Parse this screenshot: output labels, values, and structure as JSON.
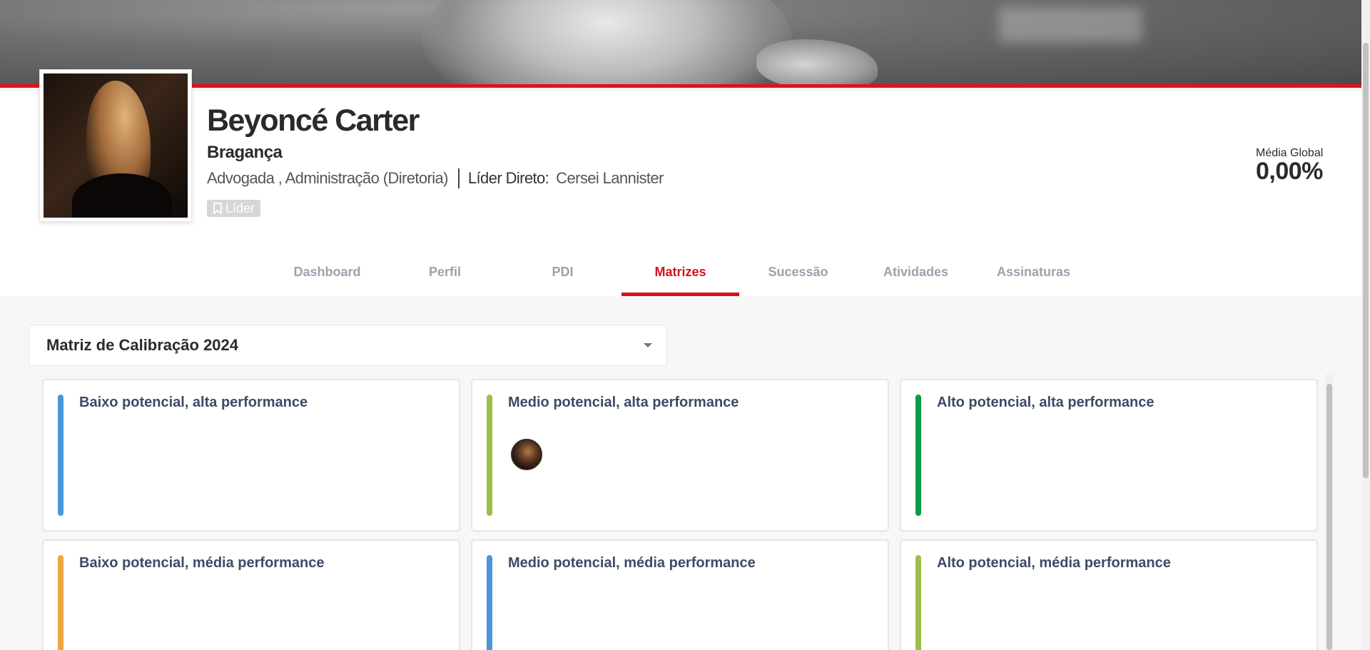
{
  "profile": {
    "name": "Beyoncé Carter",
    "subname": "Bragança",
    "role": "Advogada , Administração (Diretoria)",
    "leader_label": "Líder Direto:",
    "leader_name": "Cersei Lannister",
    "badge": "Líder",
    "badge_icon": "bookmark-icon"
  },
  "media_global": {
    "label": "Média Global",
    "value": "0,00%"
  },
  "tabs": [
    {
      "label": "Dashboard"
    },
    {
      "label": "Perfil"
    },
    {
      "label": "PDI"
    },
    {
      "label": "Matrizes",
      "active": true
    },
    {
      "label": "Sucessão"
    },
    {
      "label": "Atividades"
    },
    {
      "label": "Assinaturas"
    }
  ],
  "matrix_select": {
    "value": "Matriz de Calibração 2024"
  },
  "matrix": {
    "cells": [
      {
        "title": "Baixo potencial, alta performance",
        "color": "#4a98db"
      },
      {
        "title": "Medio potencial, alta performance",
        "color": "#9bc04a"
      },
      {
        "title": "Alto potencial, alta performance",
        "color": "#0f9a4a"
      },
      {
        "title": "Baixo potencial, média performance",
        "color": "#eba73f"
      },
      {
        "title": "Medio potencial, média performance",
        "color": "#4a98db"
      },
      {
        "title": "Alto potencial, média performance",
        "color": "#9bc04a"
      }
    ]
  },
  "colors": {
    "accent": "#d3121a",
    "banner_border": "#e3101b"
  }
}
